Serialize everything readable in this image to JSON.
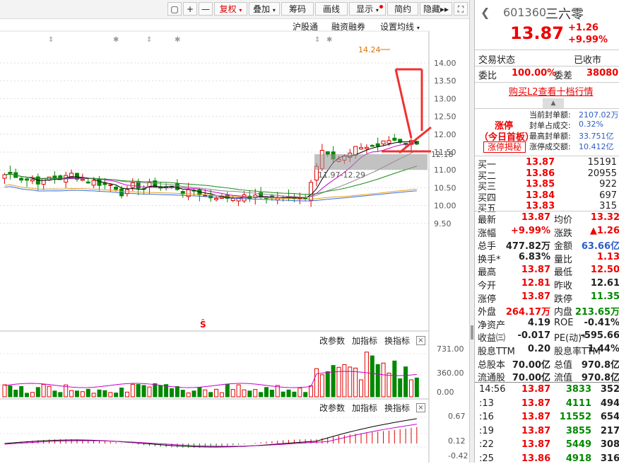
{
  "toolbar": {
    "plus": "+",
    "minus": "—",
    "fuquan": "复权",
    "diejia": "叠加",
    "chouma": "筹码",
    "huaxian": "画线",
    "xianshi": "显示",
    "jianyue": "简约",
    "yincang": "隐藏",
    "expand": "⛶"
  },
  "subbar": {
    "hgt": "沪股通",
    "rzrq": "融资融券",
    "szjx": "设置均线"
  },
  "price_chart": {
    "yaxis": [
      "14.00",
      "13.50",
      "13.00",
      "12.50",
      "12.00",
      "11.50",
      "11.00",
      "10.50",
      "10.00",
      "9.50"
    ],
    "high_label": "14.24",
    "cur_price_label": "12.18",
    "gap_label": "11.97-12.29",
    "s_mark": "Ŝ"
  },
  "volume_panel": {
    "gaicanshu": "改参数",
    "jiazhibiao": "加指标",
    "huanzhibiao": "换指标",
    "close": "×",
    "yaxis": [
      "731.00",
      "360.00",
      "0.00"
    ]
  },
  "macd_panel": {
    "gaicanshu": "改参数",
    "jiazhibiao": "加指标",
    "huanzhibiao": "换指标",
    "close": "×",
    "yaxis": [
      "0.67",
      "0.12",
      "-0.42"
    ]
  },
  "quote": {
    "code": "601360",
    "name": "三六零",
    "price": "13.87",
    "change": "+1.26",
    "pct": "+9.99%",
    "status_label": "交易状态",
    "status_value": "已收市",
    "weibi_label": "委比",
    "weibi": "100.00%",
    "weicha_label": "委差",
    "weicha": "38080",
    "l2_link": "购买L2查看十档行情",
    "zt_title": "涨停",
    "zt_sub": "（今日首板）",
    "zt_btn": "涨停揭秘",
    "seal_rows": [
      {
        "label": "当前封单额:",
        "value": "2107.02万"
      },
      {
        "label": "封单占成交:",
        "value": "0.32%"
      },
      {
        "label": "最高封单额:",
        "value": "33.751亿"
      },
      {
        "label": "涨停成交额:",
        "value": "10.412亿"
      }
    ],
    "bids": [
      {
        "label": "买一",
        "price": "13.87",
        "vol": "15191"
      },
      {
        "label": "买二",
        "price": "13.86",
        "vol": "20955"
      },
      {
        "label": "买三",
        "price": "13.85",
        "vol": "922"
      },
      {
        "label": "买四",
        "price": "13.84",
        "vol": "697"
      },
      {
        "label": "买五",
        "price": "13.83",
        "vol": "315"
      }
    ],
    "stats": [
      {
        "l1": "最新",
        "v1": "13.87",
        "c1": "red",
        "l2": "均价",
        "v2": "13.32",
        "c2": "red"
      },
      {
        "l1": "涨幅",
        "v1": "+9.99%",
        "c1": "red",
        "l2": "涨跌",
        "v2": "▲1.26",
        "c2": "red"
      },
      {
        "l1": "总手",
        "v1": "477.82万",
        "c1": "dark",
        "l2": "金额",
        "v2": "63.66亿",
        "c2": "blue"
      },
      {
        "l1": "换手*",
        "v1": "6.83%",
        "c1": "dark",
        "l2": "量比",
        "v2": "1.13",
        "c2": "red"
      },
      {
        "l1": "最高",
        "v1": "13.87",
        "c1": "red",
        "l2": "最低",
        "v2": "12.50",
        "c2": "red"
      },
      {
        "l1": "今开",
        "v1": "12.81",
        "c1": "red",
        "l2": "昨收",
        "v2": "12.61",
        "c2": "dark"
      },
      {
        "l1": "涨停",
        "v1": "13.87",
        "c1": "red",
        "l2": "跌停",
        "v2": "11.35",
        "c2": "green"
      },
      {
        "l1": "外盘",
        "v1": "264.17万",
        "c1": "red",
        "l2": "内盘",
        "v2": "213.65万",
        "c2": "green"
      },
      {
        "l1": "净资产",
        "v1": "4.19",
        "c1": "dark",
        "l2": "ROE",
        "v2": "-0.41%",
        "c2": "dark"
      },
      {
        "l1": "收益㈢",
        "v1": "-0.017",
        "c1": "dark",
        "l2": "PE(动)*",
        "v2": "-595.66",
        "c2": "dark"
      },
      {
        "l1": "股息TTM",
        "v1": "0.20",
        "c1": "dark",
        "l2": "股息率TTM",
        "v2": "1.44%",
        "c2": "dark"
      },
      {
        "l1": "总股本",
        "v1": "70.00亿",
        "c1": "dark",
        "l2": "总值",
        "v2": "970.8亿",
        "c2": "dark"
      },
      {
        "l1": "流通股",
        "v1": "70.00亿",
        "c1": "dark",
        "l2": "流值",
        "v2": "970.8亿",
        "c2": "dark"
      }
    ],
    "ticks": [
      {
        "t": "14:56",
        "p": "13.87",
        "v": "3833",
        "n": "352"
      },
      {
        "t": ":13",
        "p": "13.87",
        "v": "4111",
        "n": "494"
      },
      {
        "t": ":16",
        "p": "13.87",
        "v": "11552",
        "n": "654"
      },
      {
        "t": ":19",
        "p": "13.87",
        "v": "3855",
        "n": "217"
      },
      {
        "t": ":22",
        "p": "13.87",
        "v": "5449",
        "n": "308"
      },
      {
        "t": ":25",
        "p": "13.86",
        "v": "4918",
        "n": "316"
      }
    ]
  },
  "colors": {
    "up": "#e00000",
    "down": "#008800",
    "ma5": "#000000",
    "ma10": "#cc00cc",
    "ma20": "#888888",
    "ma30": "#1a8a1a",
    "ma60": "#e0a020",
    "ma120": "#3a6fd8"
  }
}
